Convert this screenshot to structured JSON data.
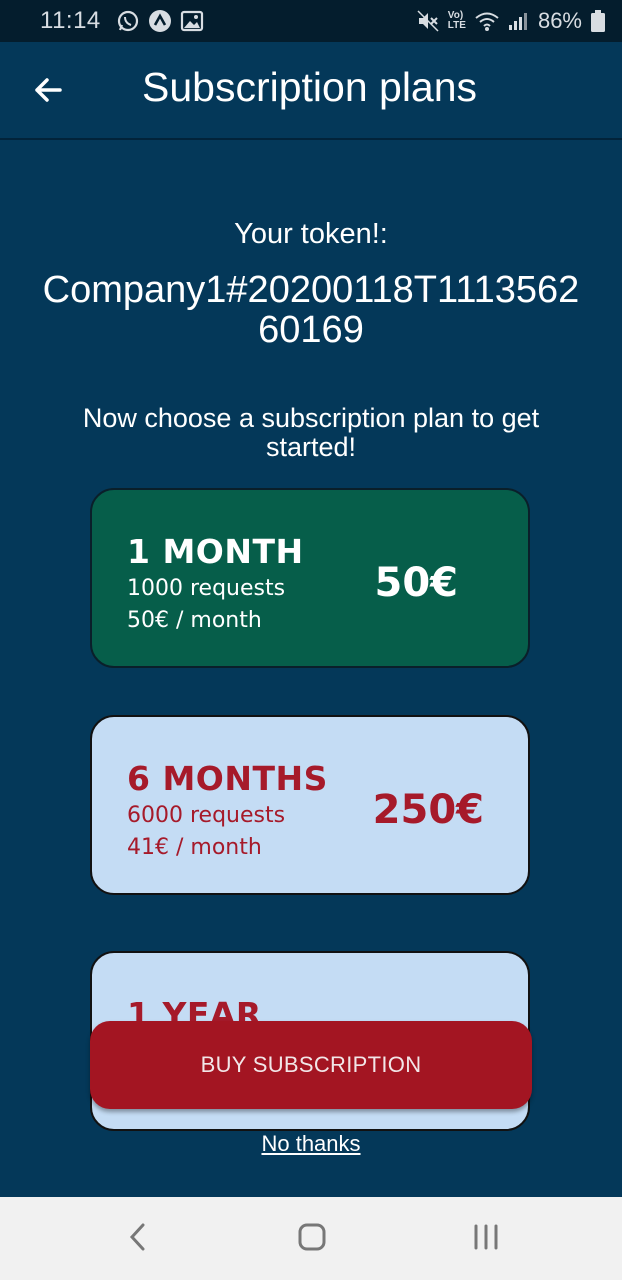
{
  "status_bar": {
    "time": "11:14",
    "battery": "86%",
    "left_icons": [
      "whatsapp-icon",
      "app-notification-icon",
      "image-icon"
    ],
    "right_icons": [
      "mute-icon",
      "volte-icon",
      "wifi-icon",
      "signal-icon",
      "battery-icon"
    ],
    "volte_label_top": "Vo)",
    "volte_label_bottom": "LTE"
  },
  "app_bar": {
    "title": "Subscription plans",
    "back_icon": "arrow-left-icon"
  },
  "token": {
    "label": "Your token!:",
    "value": "Company1#20200118T111356260169"
  },
  "instruction": "Now choose a subscription plan to get started!",
  "plans": [
    {
      "name": "1 MONTH",
      "requests": "1000 requests",
      "monthly": "50€ / month",
      "price": "50€",
      "selected": true
    },
    {
      "name": "6 MONTHS",
      "requests": "6000 requests",
      "monthly": "41€ / month",
      "price": "250€",
      "selected": false
    },
    {
      "name": "1 YEAR",
      "selected": false
    }
  ],
  "buy_button_label": "BUY SUBSCRIPTION",
  "no_thanks_label": "No thanks",
  "colors": {
    "background": "#043859",
    "selected_card": "#065e4a",
    "unselected_card": "#c4dcf4",
    "accent_red": "#a31522"
  },
  "nav_bar": [
    "back-nav-icon",
    "home-nav-icon",
    "recents-nav-icon"
  ]
}
